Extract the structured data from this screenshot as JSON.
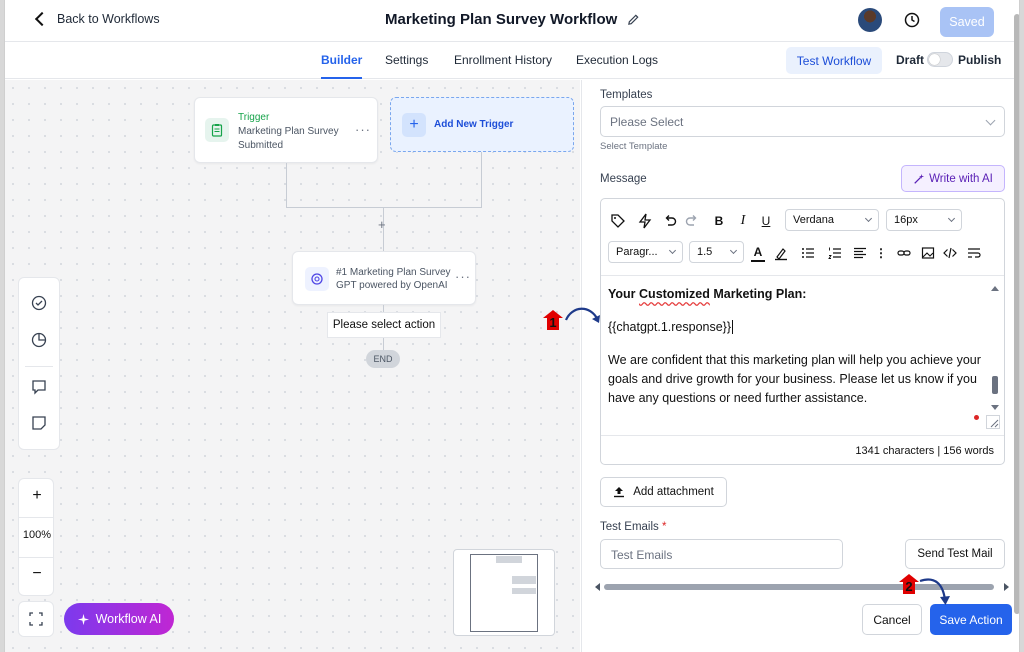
{
  "header": {
    "back_label": "Back to Workflows",
    "title": "Marketing Plan Survey Workflow",
    "saved_label": "Saved"
  },
  "tabs": [
    {
      "label": "Builder",
      "active": true
    },
    {
      "label": "Settings"
    },
    {
      "label": "Enrollment History"
    },
    {
      "label": "Execution Logs"
    }
  ],
  "actions": {
    "test_workflow": "Test Workflow",
    "draft": "Draft",
    "publish": "Publish"
  },
  "canvas": {
    "trigger": {
      "label": "Trigger",
      "subtitle": "Marketing Plan Survey Submitted"
    },
    "add_trigger": "Add New Trigger",
    "gpt_node": {
      "line1": "#1 Marketing Plan Survey",
      "line2": "GPT powered by OpenAI"
    },
    "select_action": "Please select action",
    "end": "END",
    "zoom": "100%",
    "workflow_ai": "Workflow AI"
  },
  "panel": {
    "templates_label": "Templates",
    "templates_placeholder": "Please Select",
    "templates_hint": "Select Template",
    "message_label": "Message",
    "write_ai": "Write with AI",
    "font": "Verdana",
    "font_size": "16px",
    "paragraph": "Paragr...",
    "line_height": "1.5",
    "content": {
      "heading_pre": "Your ",
      "heading_underlined": "Customized",
      "heading_post": " Marketing Plan:",
      "variable": "{{chatgpt.1.response}}",
      "body": "We are confident that this marketing plan will help you achieve your goals and drive growth for your business. Please let us know if you have any questions or need further assistance."
    },
    "counter": "1341 characters | 156 words",
    "add_attachment": "Add attachment",
    "test_emails_label": "Test Emails",
    "test_emails_required": "*",
    "test_emails_placeholder": "Test Emails",
    "send_test_mail": "Send Test Mail",
    "cancel": "Cancel",
    "save_action": "Save Action"
  },
  "annotations": {
    "step1": "1",
    "step2": "2",
    "badge_color": "#e00000",
    "arrow_color": "#1e3a8a"
  }
}
